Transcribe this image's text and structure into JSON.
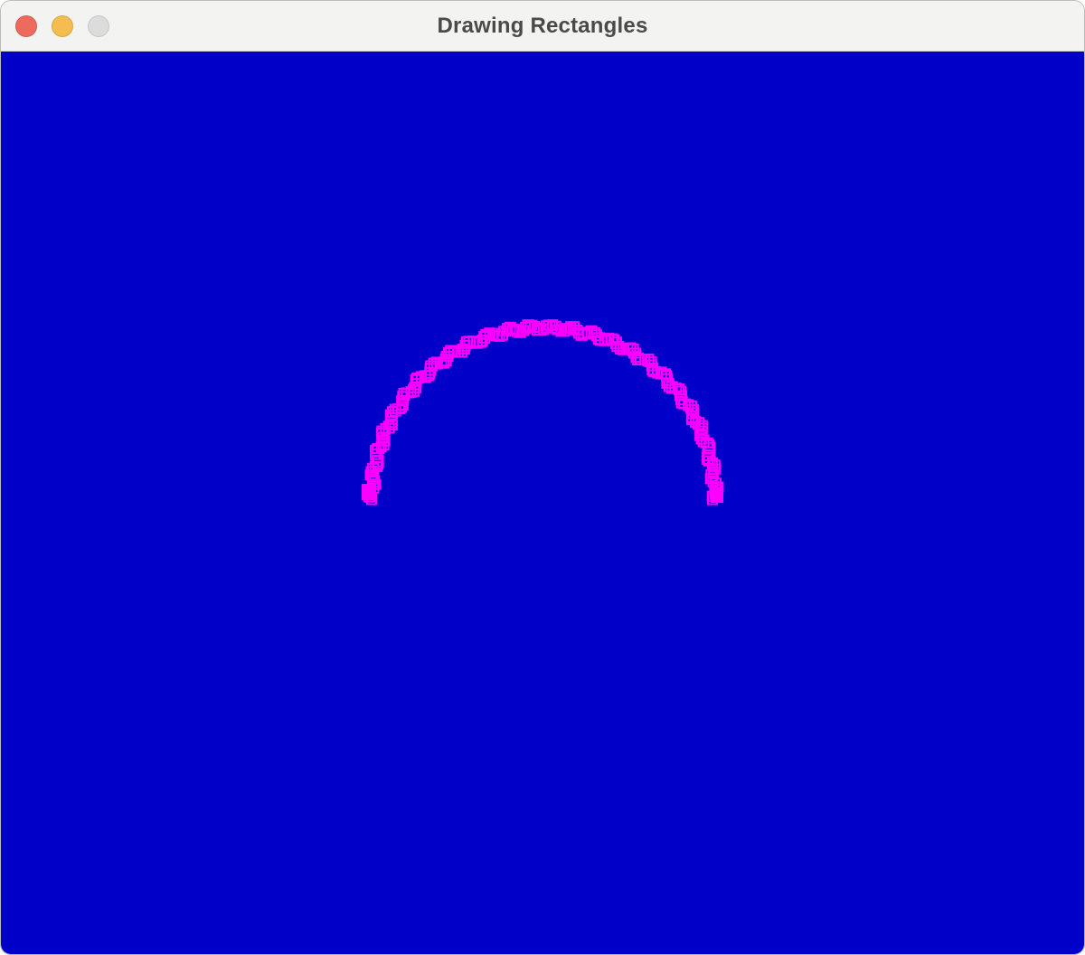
{
  "window": {
    "title": "Drawing Rectangles"
  },
  "traffic_lights": {
    "close": {
      "icon": "close-dot-icon",
      "color": "#ee6a5f"
    },
    "minimize": {
      "icon": "minimize-dot-icon",
      "color": "#f5bd4f"
    },
    "zoom": {
      "icon": "zoom-dot-icon-disabled",
      "color": "#dcdcdc"
    }
  },
  "canvas": {
    "background_color": "#0000c8",
    "shape_color": "#ff00ff",
    "shape": "arc of many small rectangles"
  }
}
